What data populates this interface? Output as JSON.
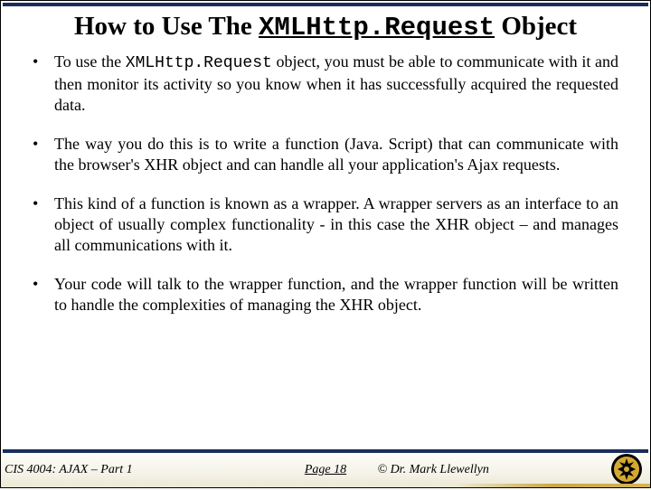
{
  "title": {
    "prefix": "How to Use The ",
    "mono": "XMLHttp.Request",
    "suffix": " Object"
  },
  "bullets": [
    {
      "parts": [
        {
          "text": "To use the ",
          "mono": false
        },
        {
          "text": "XMLHttp.Request",
          "mono": true
        },
        {
          "text": " object, you must be able to communicate with it and then monitor its activity so you know when it has successfully acquired the requested data.",
          "mono": false
        }
      ]
    },
    {
      "parts": [
        {
          "text": "The way you do this is to write a function (Java. Script) that can communicate with the browser's XHR object and can handle all your application's Ajax requests.",
          "mono": false
        }
      ]
    },
    {
      "parts": [
        {
          "text": "This kind of a function is known as a wrapper.  A wrapper servers as an interface to an object of usually complex functionality - in this case the XHR object – and manages all communications with it.",
          "mono": false
        }
      ]
    },
    {
      "parts": [
        {
          "text": "Your code will talk to the wrapper function, and the wrapper function will be written to handle the complexities of managing the XHR object.",
          "mono": false
        }
      ]
    }
  ],
  "footer": {
    "course": "CIS 4004: AJAX – Part 1",
    "page": "Page 18",
    "copyright": "© Dr. Mark Llewellyn"
  }
}
